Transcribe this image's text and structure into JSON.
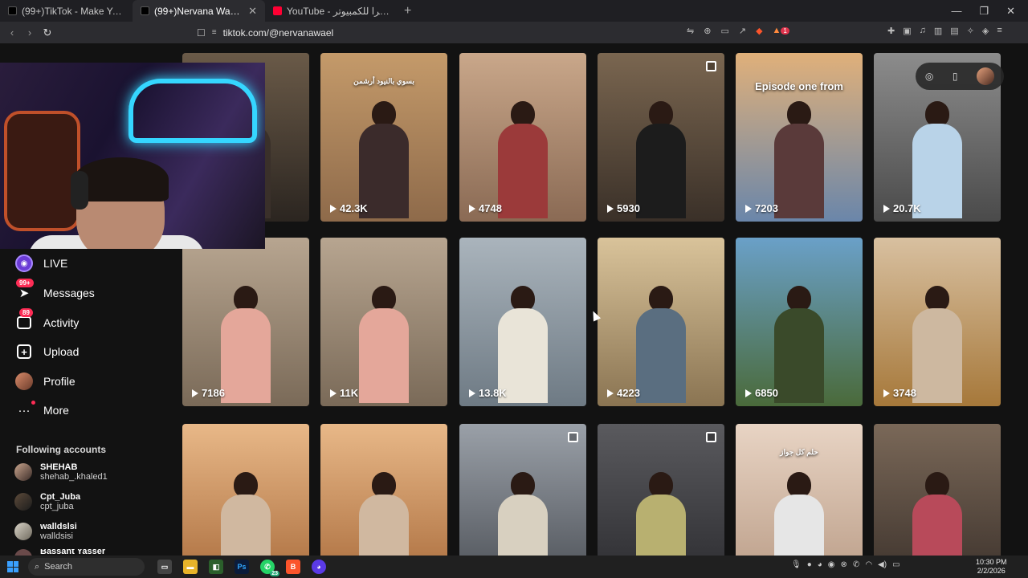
{
  "browser": {
    "tabs": [
      {
        "label": "(99+)TikTok - Make Your Day",
        "icon": "tiktok-icon",
        "active": false
      },
      {
        "label": "(99+)Nervana Wael (@nervanawael)",
        "icon": "tiktok-icon",
        "active": true
      },
      {
        "label": "YouTube - أفضل كاميرا للكمبيوتر",
        "icon": "youtube-icon",
        "active": false
      }
    ],
    "url": "tiktok.com/@nervanawael",
    "ext_badge": "1"
  },
  "sidebar": {
    "items": [
      {
        "label": "LIVE",
        "icon": "live-icon",
        "badge": ""
      },
      {
        "label": "Messages",
        "icon": "messages-icon",
        "badge": "99+"
      },
      {
        "label": "Activity",
        "icon": "activity-icon",
        "badge": "89"
      },
      {
        "label": "Upload",
        "icon": "upload-icon",
        "badge": ""
      },
      {
        "label": "Profile",
        "icon": "profile-avatar-icon",
        "badge": ""
      },
      {
        "label": "More",
        "icon": "more-icon",
        "badge": ""
      }
    ],
    "following_title": "Following accounts",
    "following": [
      {
        "name": "SHEHAB",
        "handle": "shehab_.khaled1"
      },
      {
        "name": "Cpt_Juba",
        "handle": "cpt_juba"
      },
      {
        "name": "walldslsi",
        "handle": "walldsisi"
      },
      {
        "name": "Bassant Yasser",
        "handle": ""
      }
    ]
  },
  "videos": [
    {
      "views": "",
      "caption": ""
    },
    {
      "views": "42.3K",
      "caption": "بسوي بالنيود أرشمن"
    },
    {
      "views": "4748",
      "caption": ""
    },
    {
      "views": "5930",
      "caption": ""
    },
    {
      "views": "7203",
      "caption": "Episode one from"
    },
    {
      "views": "20.7K",
      "caption": ""
    },
    {
      "views": "7186",
      "caption": ""
    },
    {
      "views": "11K",
      "caption": ""
    },
    {
      "views": "13.8K",
      "caption": ""
    },
    {
      "views": "4223",
      "caption": ""
    },
    {
      "views": "6850",
      "caption": ""
    },
    {
      "views": "3748",
      "caption": ""
    },
    {
      "views": "",
      "caption": ""
    },
    {
      "views": "",
      "caption": ""
    },
    {
      "views": "",
      "caption": ""
    },
    {
      "views": "",
      "caption": ""
    },
    {
      "views": "",
      "caption": "حلم كل جواز"
    },
    {
      "views": "",
      "caption": ""
    }
  ],
  "taskbar": {
    "search_label": "Search",
    "time": "10:30 PM",
    "date": "2/2/2026",
    "whatsapp_badge": "23"
  }
}
